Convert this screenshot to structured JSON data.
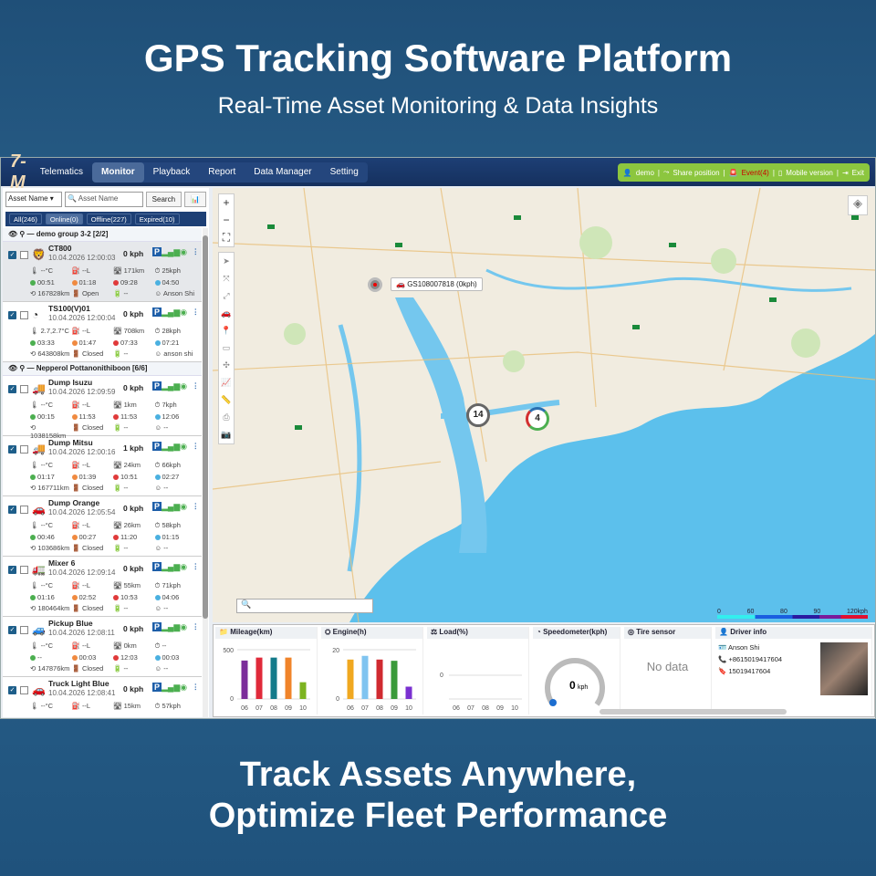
{
  "hero": {
    "title": "GPS Tracking Software Platform",
    "subtitle": "Real-Time Asset Monitoring & Data Insights",
    "tagline1": "Track Assets Anywhere,",
    "tagline2": "Optimize Fleet Performance"
  },
  "app": {
    "logo": "Telematics",
    "logo_mark": "7-M",
    "nav": [
      "Monitor",
      "Playback",
      "Report",
      "Data Manager",
      "Setting"
    ],
    "right_bar": {
      "user": "demo",
      "share": "Share position",
      "alarm": "Event(4)",
      "mobile": "Mobile version",
      "exit": "Exit"
    },
    "search": {
      "field": "Asset Name",
      "placeholder": "Asset Name",
      "button": "Search"
    },
    "tabs": [
      "All(246)",
      "Online(0)",
      "Offline(227)",
      "Expired(10)"
    ],
    "groups": [
      "demo group 3-2 [2/2]",
      "Nepperol Pottanonithiboon [6/6]"
    ],
    "vehicles": [
      {
        "group": 0,
        "name": "CT800",
        "time": "10.04.2026 12:00:03",
        "speed": "0 kph",
        "temp": "--°C",
        "fuel": "--L",
        "mileage": "171km",
        "avg": "25kph",
        "t1": "00:51",
        "t2": "01:18",
        "t3": "09:28",
        "t4": "04:50",
        "total": "167828km",
        "door": "Open",
        "battery": "--",
        "driver": "Anson Shi",
        "icon": "🦁"
      },
      {
        "group": 0,
        "name": "TS100(V)01",
        "time": "10.04.2026 12:00:04",
        "speed": "0 kph",
        "temp": "2.7,2.7°C",
        "fuel": "--L",
        "mileage": "708km",
        "avg": "28kph",
        "t1": "03:33",
        "t2": "01:47",
        "t3": "07:33",
        "t4": "07:21",
        "total": "643808km",
        "door": "Closed",
        "battery": "--",
        "driver": "anson shi",
        "icon": "◔"
      },
      {
        "group": 1,
        "name": "Dump Isuzu",
        "time": "10.04.2026 12:09:59",
        "speed": "0 kph",
        "temp": "--°C",
        "fuel": "--L",
        "mileage": "1km",
        "avg": "7kph",
        "t1": "00:15",
        "t2": "11:53",
        "t3": "11:53",
        "t4": "12:06",
        "total": "1038158km",
        "door": "Closed",
        "battery": "--",
        "driver": "--",
        "icon": "🚚"
      },
      {
        "group": 1,
        "name": "Dump Mitsu",
        "time": "10.04.2026 12:00:16",
        "speed": "1 kph",
        "temp": "--°C",
        "fuel": "--L",
        "mileage": "24km",
        "avg": "66kph",
        "t1": "01:17",
        "t2": "01:39",
        "t3": "10:51",
        "t4": "02:27",
        "total": "167711km",
        "door": "Closed",
        "battery": "--",
        "driver": "--",
        "icon": "🚚"
      },
      {
        "group": 1,
        "name": "Dump Orange",
        "time": "10.04.2026 12:05:54",
        "speed": "0 kph",
        "temp": "--°C",
        "fuel": "--L",
        "mileage": "26km",
        "avg": "58kph",
        "t1": "00:46",
        "t2": "00:27",
        "t3": "11:20",
        "t4": "01:15",
        "total": "103686km",
        "door": "Closed",
        "battery": "--",
        "driver": "--",
        "icon": "🚗"
      },
      {
        "group": 1,
        "name": "Mixer 6",
        "time": "10.04.2026 12:09:14",
        "speed": "0 kph",
        "temp": "--°C",
        "fuel": "--L",
        "mileage": "55km",
        "avg": "71kph",
        "t1": "01:16",
        "t2": "02:52",
        "t3": "10:53",
        "t4": "04:06",
        "total": "180464km",
        "door": "Closed",
        "battery": "--",
        "driver": "--",
        "icon": "🚛"
      },
      {
        "group": 1,
        "name": "Pickup Blue",
        "time": "10.04.2026 12:08:11",
        "speed": "0 kph",
        "temp": "--°C",
        "fuel": "--L",
        "mileage": "0km",
        "avg": "--",
        "t1": "--",
        "t2": "00:03",
        "t3": "12:03",
        "t4": "00:03",
        "total": "147876km",
        "door": "Closed",
        "battery": "--",
        "driver": "--",
        "icon": "🚙"
      },
      {
        "group": 1,
        "name": "Truck Light Blue",
        "time": "10.04.2026 12:08:41",
        "speed": "0 kph",
        "temp": "--°C",
        "fuel": "--L",
        "mileage": "15km",
        "avg": "57kph",
        "t1": "",
        "t2": "",
        "t3": "",
        "t4": "",
        "total": "",
        "door": "",
        "battery": "",
        "driver": "",
        "icon": "🚗"
      }
    ],
    "map": {
      "marker_label": "GS108007818 (0kph)",
      "clusters": [
        "14",
        "4"
      ],
      "speed_legend": [
        "0",
        "60",
        "80",
        "90",
        "120kph"
      ]
    },
    "panels": {
      "mileage": {
        "title": "Mileage(km)",
        "ylim": [
          0,
          500
        ],
        "categories": [
          "06",
          "07",
          "08",
          "09",
          "10"
        ],
        "values": [
          390,
          420,
          420,
          420,
          170
        ],
        "colors": [
          "#7b2d9a",
          "#e02a3a",
          "#137a8a",
          "#f0842a",
          "#7cb320"
        ]
      },
      "engine": {
        "title": "Engine(h)",
        "ylim": [
          0,
          20
        ],
        "categories": [
          "06",
          "07",
          "08",
          "09",
          "10"
        ],
        "values": [
          16,
          17.5,
          16,
          15.5,
          5
        ],
        "colors": [
          "#f0a820",
          "#80c4f0",
          "#d02a30",
          "#3a9a3a",
          "#7a30d0"
        ]
      },
      "load": {
        "title": "Load(%)",
        "y_tick": "0",
        "categories": [
          "06",
          "07",
          "08",
          "09",
          "10"
        ]
      },
      "speedometer": {
        "title": "Speedometer(kph)",
        "value": "0",
        "unit": "kph"
      },
      "tire": {
        "title": "Tire sensor",
        "empty": "No data"
      },
      "driver": {
        "title": "Driver info",
        "name": "Anson Shi",
        "phone": "+8615019417604",
        "id": "15019417604"
      }
    }
  }
}
